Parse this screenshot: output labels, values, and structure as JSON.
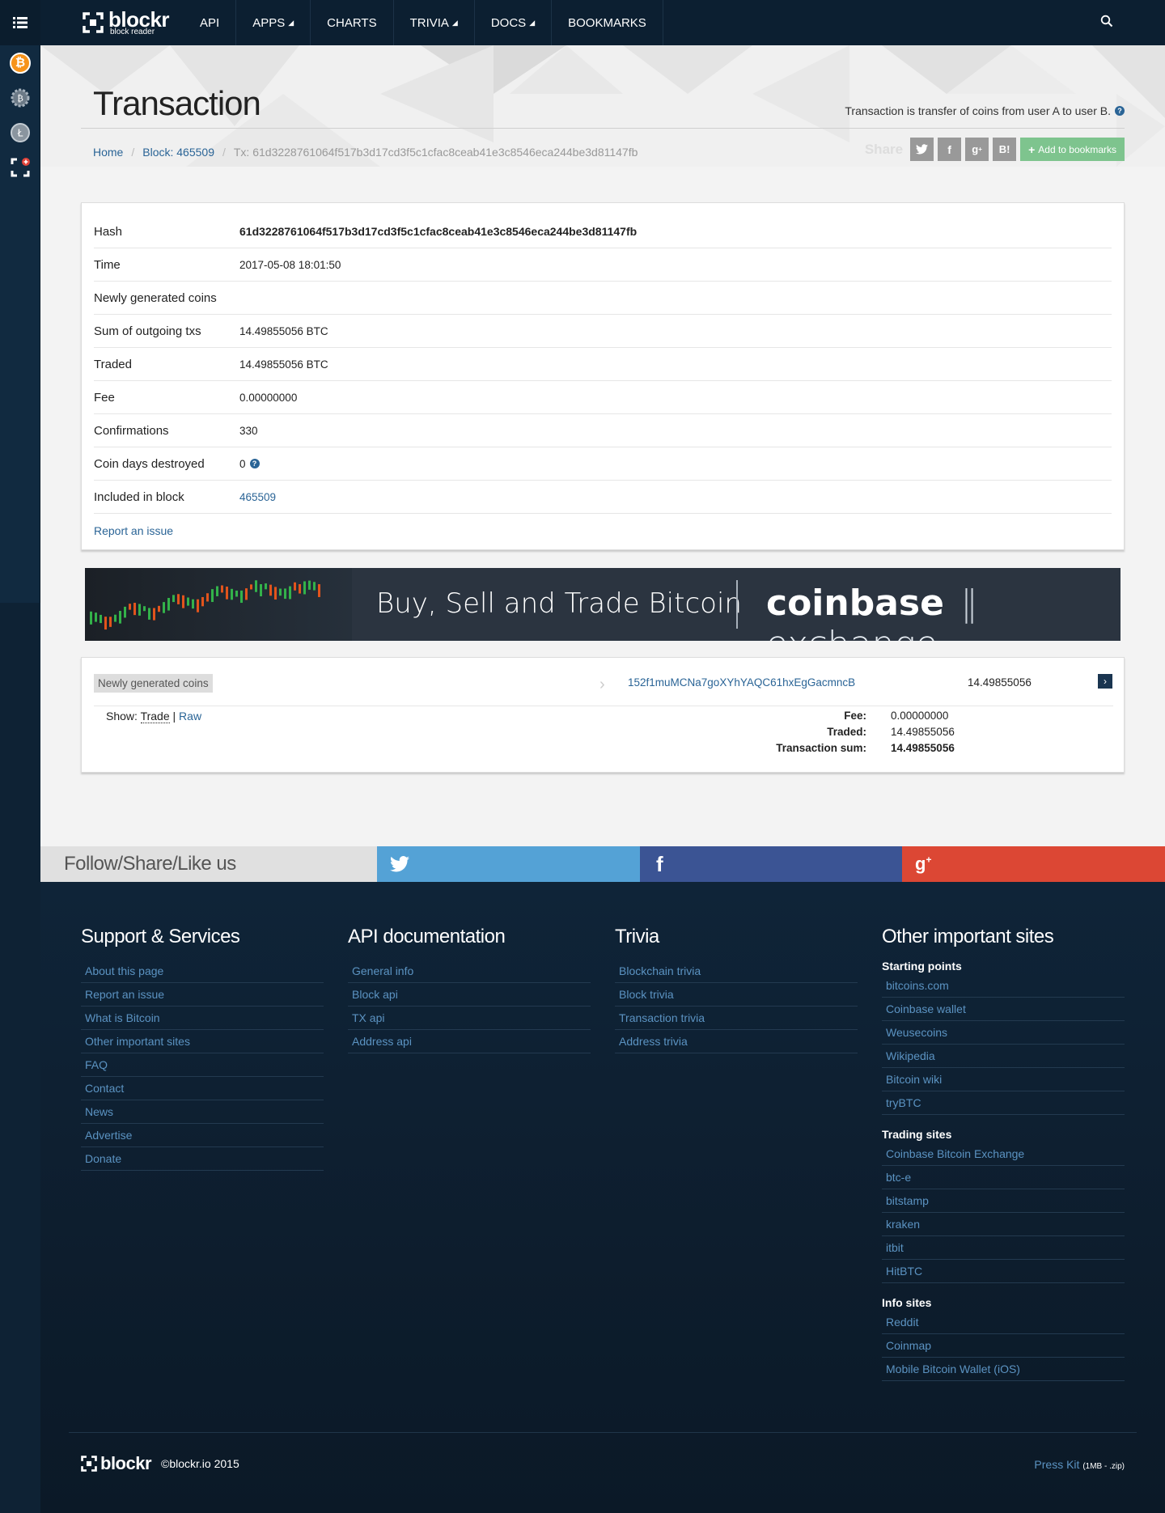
{
  "nav": {
    "logo": "blockr",
    "logo_sub": "block reader",
    "items": [
      {
        "label": "API",
        "caret": false
      },
      {
        "label": "APPS",
        "caret": true
      },
      {
        "label": "CHARTS",
        "caret": false
      },
      {
        "label": "TRIVIA",
        "caret": true
      },
      {
        "label": "DOCS",
        "caret": true
      },
      {
        "label": "BOOKMARKS",
        "caret": false
      }
    ]
  },
  "page": {
    "title": "Transaction",
    "description": "Transaction is transfer of coins from user A to user B.",
    "breadcrumb": {
      "home": "Home",
      "block": "Block: 465509",
      "tx": "Tx: 61d3228761064f517b3d17cd3f5c1cfac8ceab41e3c8546eca244be3d81147fb"
    },
    "share_label": "Share",
    "share_buttons": [
      "twitter",
      "facebook",
      "google-plus",
      "hatena"
    ],
    "bookmark_label": "Add to bookmarks"
  },
  "tx": {
    "rows": [
      {
        "key": "Hash",
        "value": "61d3228761064f517b3d17cd3f5c1cfac8ceab41e3c8546eca244be3d81147fb"
      },
      {
        "key": "Time",
        "value": "2017-05-08 18:01:50"
      },
      {
        "key": "Newly generated coins",
        "value": ""
      },
      {
        "key": "Sum of outgoing txs",
        "value": "14.49855056 BTC"
      },
      {
        "key": "Traded",
        "value": "14.49855056 BTC"
      },
      {
        "key": "Fee",
        "value": "0.00000000"
      },
      {
        "key": "Confirmations",
        "value": "330"
      },
      {
        "key": "Coin days destroyed",
        "value": "0"
      },
      {
        "key": "Included in block",
        "value": "465509"
      }
    ],
    "report_label": "Report an issue"
  },
  "ad": {
    "text": "Buy, Sell and Trade Bitcoin",
    "brand_a": "coinbase",
    "brand_b": "exchange"
  },
  "io": {
    "input_label": "Newly generated coins",
    "output_address": "152f1muMCNa7goXYhYAQC61hxEgGacmncB",
    "output_amount": "14.49855056",
    "show_label": "Show:",
    "show_trade": "Trade",
    "show_sep": "|",
    "show_raw": "Raw",
    "fee_label": "Fee:",
    "fee_value": "0.00000000",
    "traded_label": "Traded:",
    "traded_value": "14.49855056",
    "sum_label": "Transaction sum:",
    "sum_value": "14.49855056"
  },
  "social": {
    "follow_label": "Follow/Share/Like us",
    "colors": {
      "twitter": "#54a2d6",
      "facebook": "#3b5494",
      "google": "#dc4734"
    }
  },
  "footer": {
    "support": {
      "title": "Support & Services",
      "links": [
        "About this page",
        "Report an issue",
        "What is Bitcoin",
        "Other important sites",
        "FAQ",
        "Contact",
        "News",
        "Advertise",
        "Donate"
      ]
    },
    "api": {
      "title": "API documentation",
      "links": [
        "General info",
        "Block api",
        "TX api",
        "Address api"
      ]
    },
    "trivia": {
      "title": "Trivia",
      "links": [
        "Blockchain trivia",
        "Block trivia",
        "Transaction trivia",
        "Address trivia"
      ]
    },
    "other": {
      "title": "Other important sites",
      "groups": [
        {
          "title": "Starting points",
          "links": [
            "bitcoins.com",
            "Coinbase wallet",
            "Weusecoins",
            "Wikipedia",
            "Bitcoin wiki",
            "tryBTC"
          ]
        },
        {
          "title": "Trading sites",
          "links": [
            "Coinbase Bitcoin Exchange",
            "btc-e",
            "bitstamp",
            "kraken",
            "itbit",
            "HitBTC"
          ]
        },
        {
          "title": "Info sites",
          "links": [
            "Reddit",
            "Coinmap",
            "Mobile Bitcoin Wallet (iOS)"
          ]
        }
      ]
    },
    "logo": "blockr",
    "copyright": "©blockr.io 2015",
    "press_kit": "Press Kit",
    "press_kit_size": "(1MB - .zip)"
  }
}
